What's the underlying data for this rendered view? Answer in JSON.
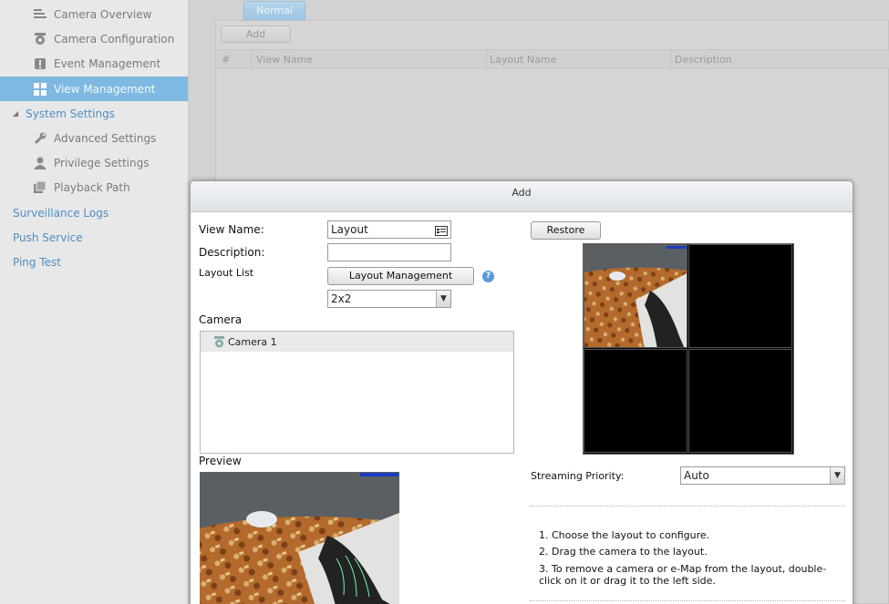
{
  "sidebar": {
    "items": [
      {
        "label": "Camera Overview",
        "icon": "list-icon"
      },
      {
        "label": "Camera Configuration",
        "icon": "camera-icon"
      },
      {
        "label": "Event Management",
        "icon": "alert-icon"
      },
      {
        "label": "View Management",
        "icon": "grid-icon",
        "selected": true
      }
    ],
    "system_settings": {
      "label": "System Settings",
      "items": [
        {
          "label": "Advanced Settings",
          "icon": "wrench-icon"
        },
        {
          "label": "Privilege Settings",
          "icon": "user-icon"
        },
        {
          "label": "Playback Path",
          "icon": "folder-icon"
        }
      ]
    },
    "links": [
      "Surveillance Logs",
      "Push Service",
      "Ping Test"
    ]
  },
  "main": {
    "tab": "Normal",
    "add_label": "Add",
    "columns": [
      "#",
      "View Name",
      "Layout Name",
      "Description"
    ]
  },
  "dialog": {
    "title": "Add",
    "view_name_label": "View Name:",
    "view_name_value": "Layout",
    "description_label": "Description:",
    "description_value": "",
    "layout_list_label": "Layout List",
    "layout_management_label": "Layout Management",
    "layout_select": "2x2",
    "camera_label": "Camera",
    "cameras": [
      "Camera 1"
    ],
    "preview_label": "Preview",
    "restore_label": "Restore",
    "streaming_priority_label": "Streaming Priority:",
    "streaming_priority_value": "Auto",
    "instructions": [
      "1. Choose the layout to configure.",
      "2. Drag the camera to the layout.",
      "3. To remove a camera or e-Map from the layout, double-click on it or drag it to the left side."
    ]
  },
  "colors": {
    "selected_bg": "#7fb8e0",
    "link": "#4d8ec4"
  }
}
